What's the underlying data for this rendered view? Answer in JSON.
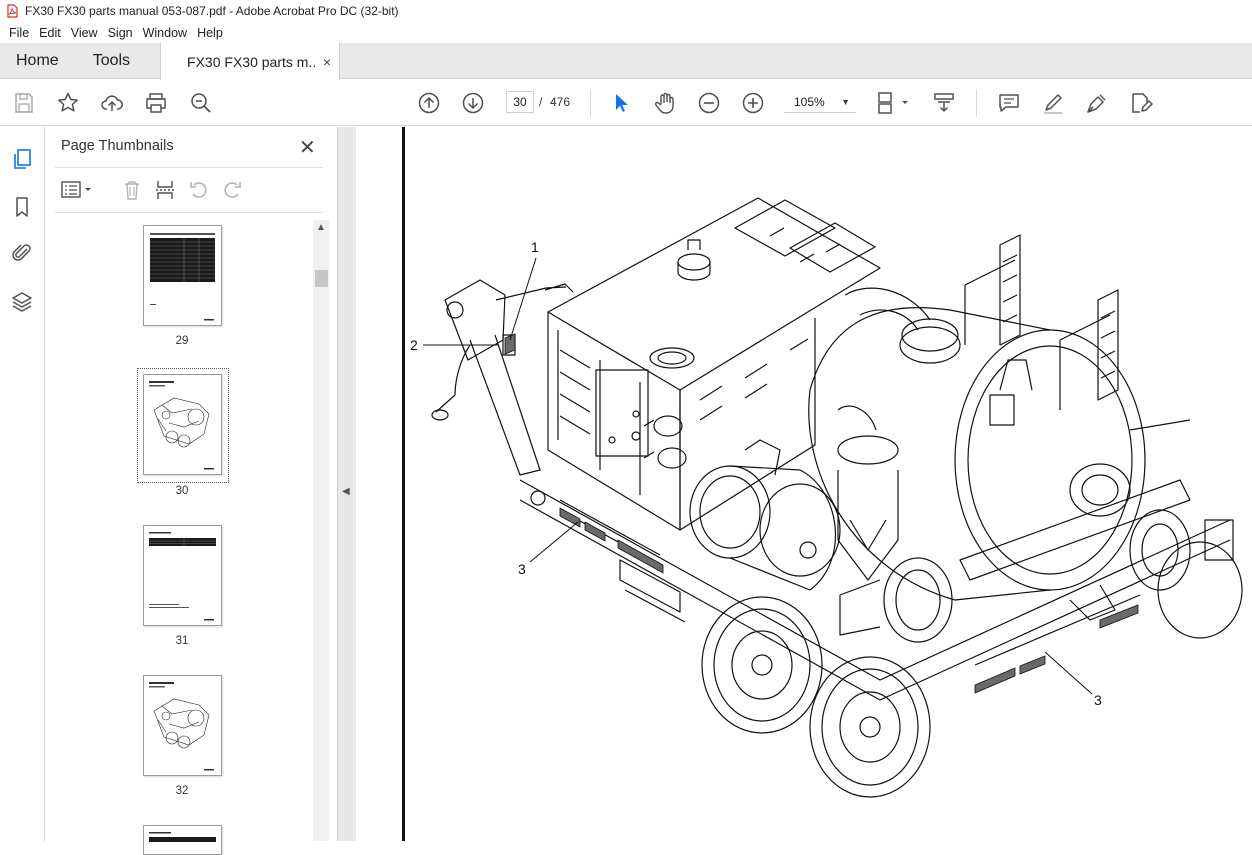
{
  "window": {
    "title": "FX30 FX30 parts manual 053-087.pdf - Adobe Acrobat Pro DC (32-bit)"
  },
  "menu": {
    "items": [
      "File",
      "Edit",
      "View",
      "Sign",
      "Window",
      "Help"
    ]
  },
  "tabs": {
    "home": "Home",
    "tools": "Tools",
    "document": "FX30 FX30 parts m...",
    "close": "×"
  },
  "toolbar": {
    "page_current": "30",
    "page_sep": "/",
    "page_total": "476",
    "zoom": "105%"
  },
  "panel": {
    "title": "Page Thumbnails",
    "close": "✕",
    "thumbnails": [
      {
        "page": "29",
        "selected": false
      },
      {
        "page": "30",
        "selected": true
      },
      {
        "page": "31",
        "selected": false
      },
      {
        "page": "32",
        "selected": false
      }
    ]
  },
  "document": {
    "callouts": [
      "1",
      "2",
      "3",
      "3"
    ]
  },
  "colors": {
    "accent": "#1473e6",
    "tab_bg": "#e9e9e9",
    "icon": "#505050"
  }
}
